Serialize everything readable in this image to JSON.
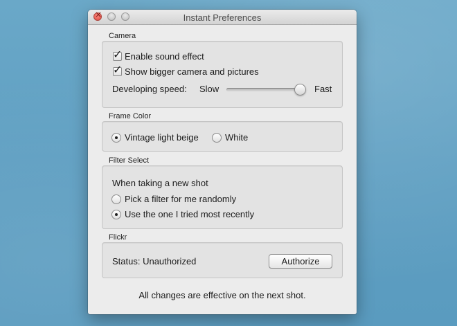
{
  "window": {
    "title": "Instant Preferences"
  },
  "camera": {
    "label": "Camera",
    "enable_sound": {
      "label": "Enable sound effect",
      "checked": true
    },
    "bigger_camera": {
      "label": "Show bigger camera and pictures",
      "checked": true
    },
    "speed": {
      "label": "Developing speed:",
      "min_label": "Slow",
      "max_label": "Fast",
      "value": 0.95
    }
  },
  "frame_color": {
    "label": "Frame Color",
    "options": [
      {
        "label": "Vintage light beige",
        "selected": true
      },
      {
        "label": "White",
        "selected": false
      }
    ]
  },
  "filter_select": {
    "label": "Filter Select",
    "prompt": "When taking a new shot",
    "options": [
      {
        "label": "Pick a filter for me randomly",
        "selected": false
      },
      {
        "label": "Use the one I tried most recently",
        "selected": true
      }
    ]
  },
  "flickr": {
    "label": "Flickr",
    "status": "Status: Unauthorized",
    "authorize_label": "Authorize"
  },
  "footer": {
    "note": "All changes are effective on the next shot."
  }
}
